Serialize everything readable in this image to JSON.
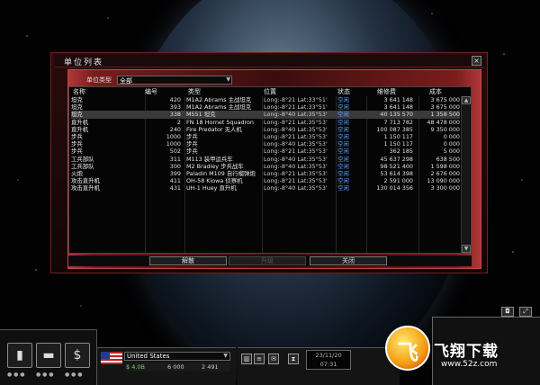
{
  "window": {
    "title": "单位列表",
    "close": "×"
  },
  "filter": {
    "label": "单位类型",
    "value": "全部"
  },
  "columns": [
    "名称",
    "编号",
    "类型",
    "位置",
    "状态",
    "维修费",
    "成本"
  ],
  "rows": [
    {
      "name": "坦克",
      "id": "420",
      "model": "M1A2 Abrams 主战坦克",
      "loc": "Long:-8°21 Lat:33°51'",
      "status": "空闲",
      "cost": "3 641 148",
      "up": "3 675 000"
    },
    {
      "name": "坦克",
      "id": "393",
      "model": "M1A2 Abrams 主战坦克",
      "loc": "Long:-8°21 Lat:33°51'",
      "status": "空闲",
      "cost": "3 641 148",
      "up": "3 675 000"
    },
    {
      "name": "坦克",
      "id": "338",
      "model": "M551 坦克",
      "loc": "Long:-8°40 Lat:35°53'",
      "status": "空闲",
      "cost": "40 135 570",
      "up": "1 358 500"
    },
    {
      "name": "直升机",
      "id": "2",
      "model": "FN 18 Hornet Squadron",
      "loc": "Long:-8°21 Lat:35°53'",
      "status": "空闲",
      "cost": "7 713 782",
      "up": "48 478 000"
    },
    {
      "name": "直升机",
      "id": "240",
      "model": "Fire Predator 无人机",
      "loc": "Long:-8°40 Lat:35°53'",
      "status": "空闲",
      "cost": "100 087 385",
      "up": "9 350 000"
    },
    {
      "name": "步兵",
      "id": "1000",
      "model": "步兵",
      "loc": "Long:-8°21 Lat:35°53'",
      "status": "空闲",
      "cost": "1 150 117",
      "up": "0 000"
    },
    {
      "name": "步兵",
      "id": "1000",
      "model": "步兵",
      "loc": "Long:-8°40 Lat:35°53'",
      "status": "空闲",
      "cost": "1 150 117",
      "up": "0 000"
    },
    {
      "name": "步兵",
      "id": "502",
      "model": "步兵",
      "loc": "Long:-8°21 Lat:35°53'",
      "status": "空闲",
      "cost": "362 185",
      "up": "5 000"
    },
    {
      "name": "工兵部队",
      "id": "311",
      "model": "M113 装甲运兵车",
      "loc": "Long:-8°40 Lat:35°53'",
      "status": "空闲",
      "cost": "45 637 298",
      "up": "638 500"
    },
    {
      "name": "工兵部队",
      "id": "300",
      "model": "M2 Bradley 步兵战车",
      "loc": "Long:-8°40 Lat:35°53'",
      "status": "空闲",
      "cost": "98 521 400",
      "up": "1 598 000"
    },
    {
      "name": "火炮",
      "id": "399",
      "model": "Paladin M109 自行榴弹炮",
      "loc": "Long:-8°21 Lat:35°53'",
      "status": "空闲",
      "cost": "53 614 398",
      "up": "2 676 000"
    },
    {
      "name": "攻击直升机",
      "id": "411",
      "model": "OH-58 Kiowa 侦察机",
      "loc": "Long:-8°21 Lat:35°53'",
      "status": "空闲",
      "cost": "2 591 000",
      "up": "13 090 000"
    },
    {
      "name": "攻击直升机",
      "id": "431",
      "model": "UH-1 Huey 直升机",
      "loc": "Long:-8°40 Lat:35°53'",
      "status": "空闲",
      "cost": "130 014 356",
      "up": "3 300 000"
    }
  ],
  "buttons": {
    "dismiss": "解散",
    "middle": "升级",
    "close": "关闭"
  },
  "hud": {
    "country": "United States",
    "money": [
      "$ 4.0B",
      "6 000",
      "2 491"
    ],
    "clock": [
      "23/11/20",
      "07:31"
    ],
    "icons": [
      "missile-icon",
      "tank-icon",
      "dollar-icon"
    ]
  },
  "watermark": {
    "logo": "飞",
    "title": "飞翔下载",
    "url": "www.52z.com"
  }
}
